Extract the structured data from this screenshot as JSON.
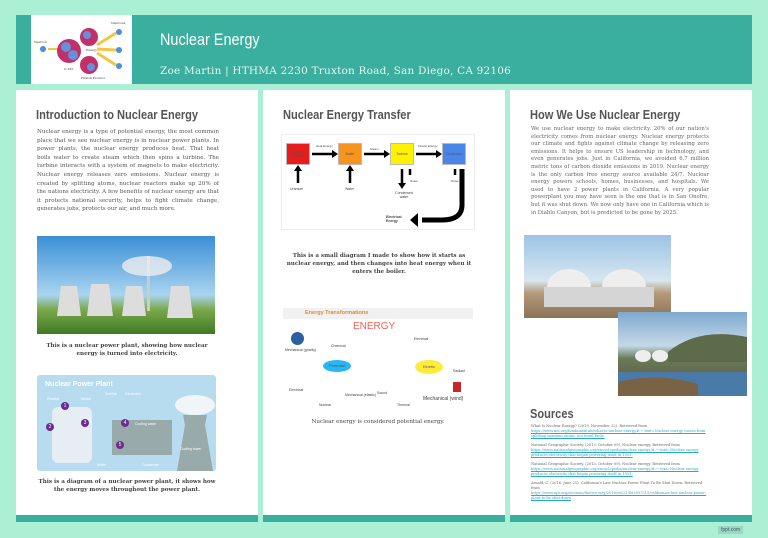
{
  "header": {
    "title": "Nuclear Energy",
    "subtitle": "Zoe Martin | HTHMA 2230 Truxton Road, San Diego, CA 92106",
    "logo_labels": {
      "neutron": "Neutron",
      "neutrons": "Neutrons",
      "energy": "Energy",
      "u235": "U-235",
      "fission": "Fission Product"
    }
  },
  "col1": {
    "heading": "Introduction to Nuclear Energy",
    "body": "Nuclear energy is a type of potential energy, the most common place that we see nuclear energy is in nuclear power plants. In power plants, the nuclear energy produces heat. That heat boils water to create steam which then spins a turbine. The turbine interacts with a system of magnets to make electricity. Nuclear energy releases zero emissions. Nuclear energy is created by splitting atoms, nuclear reactors make up 20% of the nations electricity. A few benefits of nuclear energy are that it protects national security, helps to fight climate change, generates jobs, protects our air, and much more.",
    "caption1": "This is a nuclear power plant, showing how nuclear energy  is turned into electricity.",
    "diagram": {
      "title": "Nuclear Power Plant",
      "labels": [
        "Reactor",
        "Steam",
        "Turbine",
        "Generator",
        "Cooling water",
        "Cooling tower",
        "Water",
        "Condenser"
      ],
      "steps": [
        "1",
        "2",
        "3",
        "4",
        "5"
      ]
    },
    "caption2": "This is a diagram of a nuclear power plant, it shows how the energy moves throughout the power plant."
  },
  "col2": {
    "heading": "Nuclear Energy Transfer",
    "flow": {
      "boxes": [
        "Nuclear Reactor",
        "Boiler",
        "Turbine",
        "Generator"
      ],
      "arrows": [
        "Heat Energy",
        "Steam",
        "Kinetic Energy"
      ],
      "inputs": [
        "Uranium",
        "Water",
        "Condensed water"
      ],
      "losses": [
        "Noise",
        "Noise"
      ],
      "output": "Electrical Energy"
    },
    "caption1": "This is a small diagram I made to show how it starts as nuclear energy, and then changes into heat energy when it enters the boiler.",
    "transform": {
      "title": "Energy Transformations",
      "center": "ENERGY",
      "potential": "Potential",
      "kinetic": "Kinetic",
      "potential_items": [
        "Mechanical (gravity)",
        "Chemical",
        "Electrical",
        "Nuclear",
        "Mechanical (elastic)"
      ],
      "kinetic_items": [
        "Electrical",
        "Radiant",
        "Sound",
        "Thermal",
        "Mechanical (wind)"
      ]
    },
    "caption2": "Nuclear energy is considered potential energy."
  },
  "col3": {
    "heading": "How We Use Nuclear Energy",
    "body": "We use nuclear energy to make electricity. 20% of our nation's electricity comes from nuclear energy. Nuclear energy protects our climate and fights against climate change by releasing zero emissions. It helps to ensure US leadership in technology, and even generates jobs. Just in California, we avoided 6.7 million metric tons of carbon dioxide emissions in 2019. Nuclear energy is the only carbon free energy source available 24/7. Nuclear energy powers schools, homes, businesses, and hospitals. We used to have 2 power plants in California. A very popular powerplant you may have seen is the one that is in San Onofre, but it was shut down. We now only have one in California which is in Diablo Canyon, but is predicted to be gone by 2025.",
    "sources_heading": "Sources",
    "sources": [
      {
        "text": "What Is Nuclear Energy? (2019, November 22). Retrieved from",
        "link": "https://www.nei.org/fundamentals/what-is-nuclear-energy#:~:text=Nuclear energy comes from splitting uranium atoms, not fossil fuels."
      },
      {
        "text": "National Geographic Society. (2013, October 09). Nuclear energy. Retrieved from",
        "link": "https://www.nationalgeographic.org/encyclopedia/nuclear-energy/#:~:text=Nuclear energy produces electricity that began powering itself in 1951."
      },
      {
        "text": "National Geographic Society. (2013, October 09). Nuclear energy. Retrieved from",
        "link": "https://www.nationalgeographic.org/encyclopedia/nuclear-energy/#:~:text=Nuclear energy produces electricity that began powering itself in 1951."
      },
      {
        "text": "Arnold, C. (2016, June 21). California's Last Nuclear Power Plant To Be Shut Down. Retrieved from",
        "link": "https://www.npr.org/sections/thetwo-way/2016/06/21/482897515/californias-last-nuclear-power-plant-to-be-shut-down"
      }
    ]
  },
  "footer": {
    "badge": "fppt.com"
  },
  "colors": {
    "background": "#abf0d4",
    "teal": "#3aaf9f"
  }
}
